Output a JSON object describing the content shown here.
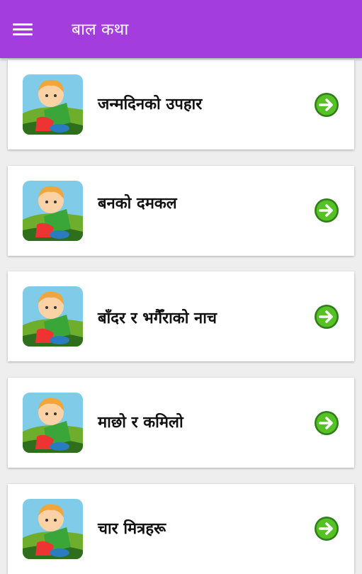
{
  "app": {
    "title": "बाल कथा"
  },
  "stories": [
    {
      "title": "जन्मदिनको उपहार"
    },
    {
      "title": "बनको दमकल"
    },
    {
      "title": "बाँदर र भगैँराको नाच"
    },
    {
      "title": " माछो र कमिलो"
    },
    {
      "title": "चार मित्रहरू"
    }
  ],
  "colors": {
    "appbar": "#a43ddd",
    "arrow": "#4fb61f"
  },
  "icons": {
    "menu": "hamburger-menu-icon",
    "thumbnail": "boy-reading-book-icon",
    "open": "right-arrow-circle-icon"
  }
}
